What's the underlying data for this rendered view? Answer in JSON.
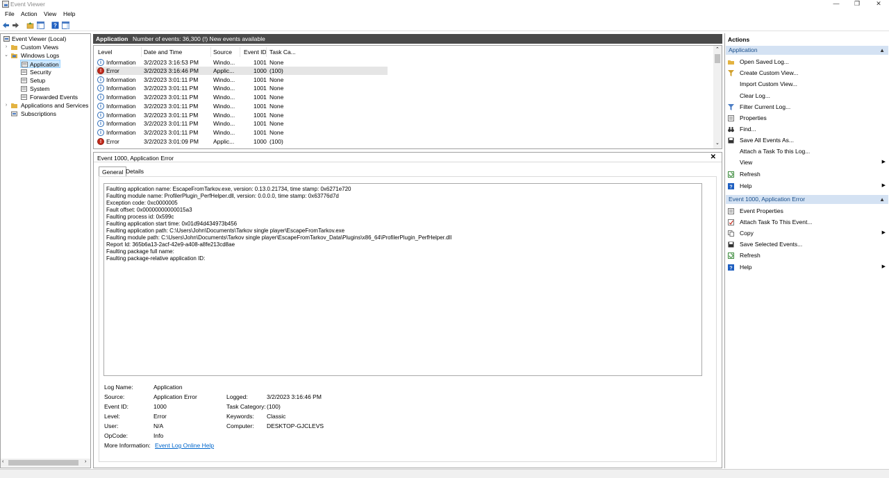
{
  "window": {
    "title": "Event Viewer"
  },
  "menu": [
    "File",
    "Action",
    "View",
    "Help"
  ],
  "tree": {
    "root": "Event Viewer (Local)",
    "custom_views": "Custom Views",
    "windows_logs": "Windows Logs",
    "application": "Application",
    "security": "Security",
    "setup": "Setup",
    "system": "System",
    "forwarded": "Forwarded Events",
    "app_services": "Applications and Services Lo",
    "subscriptions": "Subscriptions"
  },
  "list_header": {
    "title": "Application",
    "count": "Number of events: 36,300 (!) New events available"
  },
  "columns": {
    "level": "Level",
    "datetime": "Date and Time",
    "source": "Source",
    "eventid": "Event ID",
    "task": "Task Ca..."
  },
  "events": [
    {
      "level": "Information",
      "datetime": "3/2/2023 3:16:53 PM",
      "source": "Windo...",
      "eventid": "1001",
      "task": "None"
    },
    {
      "level": "Error",
      "datetime": "3/2/2023 3:16:46 PM",
      "source": "Applic...",
      "eventid": "1000",
      "task": "(100)"
    },
    {
      "level": "Information",
      "datetime": "3/2/2023 3:01:11 PM",
      "source": "Windo...",
      "eventid": "1001",
      "task": "None"
    },
    {
      "level": "Information",
      "datetime": "3/2/2023 3:01:11 PM",
      "source": "Windo...",
      "eventid": "1001",
      "task": "None"
    },
    {
      "level": "Information",
      "datetime": "3/2/2023 3:01:11 PM",
      "source": "Windo...",
      "eventid": "1001",
      "task": "None"
    },
    {
      "level": "Information",
      "datetime": "3/2/2023 3:01:11 PM",
      "source": "Windo...",
      "eventid": "1001",
      "task": "None"
    },
    {
      "level": "Information",
      "datetime": "3/2/2023 3:01:11 PM",
      "source": "Windo...",
      "eventid": "1001",
      "task": "None"
    },
    {
      "level": "Information",
      "datetime": "3/2/2023 3:01:11 PM",
      "source": "Windo...",
      "eventid": "1001",
      "task": "None"
    },
    {
      "level": "Information",
      "datetime": "3/2/2023 3:01:11 PM",
      "source": "Windo...",
      "eventid": "1001",
      "task": "None"
    },
    {
      "level": "Error",
      "datetime": "3/2/2023 3:01:09 PM",
      "source": "Applic...",
      "eventid": "1000",
      "task": "(100)"
    }
  ],
  "detail": {
    "title": "Event 1000, Application Error",
    "close": "✕",
    "tabs": {
      "general": "General",
      "details": "Details"
    },
    "description": [
      "Faulting application name: EscapeFromTarkov.exe, version: 0.13.0.21734, time stamp: 0x6271e720",
      "Faulting module name: ProfilerPlugin_PerfHelper.dll, version: 0.0.0.0, time stamp: 0x63776d7d",
      "Exception code: 0xc0000005",
      "Fault offset: 0x00000000000015a3",
      "Faulting process id: 0x599c",
      "Faulting application start time: 0x01d94d434973b456",
      "Faulting application path: C:\\Users\\John\\Documents\\Tarkov single player\\EscapeFromTarkov.exe",
      "Faulting module path: C:\\Users\\John\\Documents\\Tarkov single player\\EscapeFromTarkov_Data\\Plugins\\x86_64\\ProfilerPlugin_PerfHelper.dll",
      "Report Id: 365b6a13-2acf-42e9-a408-a8fe213cd8ae",
      "Faulting package full name:",
      "Faulting package-relative application ID:"
    ],
    "labels": {
      "log_name": "Log Name:",
      "source": "Source:",
      "event_id": "Event ID:",
      "level": "Level:",
      "user": "User:",
      "opcode": "OpCode:",
      "more_info": "More Information:",
      "logged": "Logged:",
      "task_category": "Task Category:",
      "keywords": "Keywords:",
      "computer": "Computer:"
    },
    "values": {
      "log_name": "Application",
      "source": "Application Error",
      "event_id": "1000",
      "level": "Error",
      "user": "N/A",
      "opcode": "Info",
      "more_info": "Event Log Online Help",
      "logged": "3/2/2023 3:16:46 PM",
      "task_category": "(100)",
      "keywords": "Classic",
      "computer": "DESKTOP-GJCLEVS"
    }
  },
  "actions": {
    "header": "Actions",
    "section1": "Application",
    "section1_items": [
      "Open Saved Log...",
      "Create Custom View...",
      "Import Custom View...",
      "Clear Log...",
      "Filter Current Log...",
      "Properties",
      "Find...",
      "Save All Events As...",
      "Attach a Task To this Log...",
      "View",
      "Refresh",
      "Help"
    ],
    "section2": "Event 1000, Application Error",
    "section2_items": [
      "Event Properties",
      "Attach Task To This Event...",
      "Copy",
      "Save Selected Events...",
      "Refresh",
      "Help"
    ]
  },
  "colors": {
    "accent": "#d4e2f3",
    "header_dark": "#4a4a4a",
    "error_red": "#c42b1c",
    "info_blue": "#2c6bb8",
    "link": "#0066cc"
  }
}
